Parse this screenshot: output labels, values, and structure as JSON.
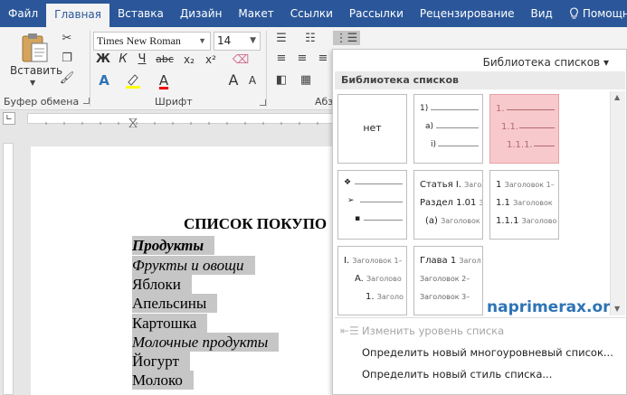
{
  "tabs": [
    "Файл",
    "Главная",
    "Вставка",
    "Дизайн",
    "Макет",
    "Ссылки",
    "Рассылки",
    "Рецензирование",
    "Вид",
    "Помощн"
  ],
  "active_tab": "Главная",
  "ribbon": {
    "paste_label": "Вставить",
    "clipboard_group": "Буфер обмена",
    "font_group": "Шрифт",
    "paragraph_group": "Абз",
    "font_name": "Times New Roman",
    "font_size": "14",
    "bold": "Ж",
    "italic": "К",
    "underline": "Ч",
    "strike": "abc",
    "subscript": "x₂",
    "superscript": "x²",
    "font_color_a": "A",
    "grow_font": "A",
    "shrink_font": "A",
    "change_case": "Aa"
  },
  "document": {
    "title": "СПИСОК ПОКУПО",
    "lines": [
      {
        "text": "Продукты",
        "style": "bi"
      },
      {
        "text": "Фрукты и овощи",
        "style": "it"
      },
      {
        "text": "Яблоки",
        "style": "n"
      },
      {
        "text": "Апельсины",
        "style": "n"
      },
      {
        "text": "Картошка",
        "style": "n"
      },
      {
        "text": "Молочные продукты",
        "style": "it"
      },
      {
        "text": "Йогурт",
        "style": "n"
      },
      {
        "text": "Молоко",
        "style": "n"
      }
    ]
  },
  "dropdown": {
    "header": "Библиотека списков",
    "section": "Библиотека списков",
    "none_label": "нет",
    "cell2": [
      "1)",
      "a)",
      "i)"
    ],
    "cell3": [
      "1.",
      "1.1.",
      "1.1.1."
    ],
    "cell4": [
      "❖",
      "➢",
      "▪"
    ],
    "cell5": {
      "l1_prefix": "Статья I.",
      "l1_rest": "Загол",
      "l2_prefix": "Раздел 1.01",
      "l2_rest": "З",
      "l3_prefix": "(a)",
      "l3_rest": "Заголовок"
    },
    "cell6": {
      "l1_prefix": "1",
      "l1_rest": "Заголовок 1–",
      "l2_prefix": "1.1",
      "l2_rest": "Заголовок",
      "l3_prefix": "1.1.1",
      "l3_rest": "Заголово"
    },
    "cell7": {
      "l1_prefix": "I.",
      "l1_rest": "Заголовок 1–",
      "l2_prefix": "A.",
      "l2_rest": "Заголово",
      "l3_prefix": "1.",
      "l3_rest": "Заголо"
    },
    "cell8": {
      "l1_prefix": "Глава 1",
      "l1_rest": "Загол",
      "l2_rest": "Заголовок 2–",
      "l3_rest": "Заголовок 3–"
    },
    "watermark": "naprimerax.org",
    "menu": [
      {
        "label": "Изменить уровень списка",
        "disabled": true
      },
      {
        "label": "Определить новый многоуровневый список...",
        "disabled": false
      },
      {
        "label": "Определить новый стиль списка...",
        "disabled": false
      }
    ]
  },
  "colors": {
    "tab_bar": "#2b579a",
    "selected_cell": "#f7c9cc",
    "watermark": "#2e74b5",
    "highlight": "#c6c6c6"
  }
}
